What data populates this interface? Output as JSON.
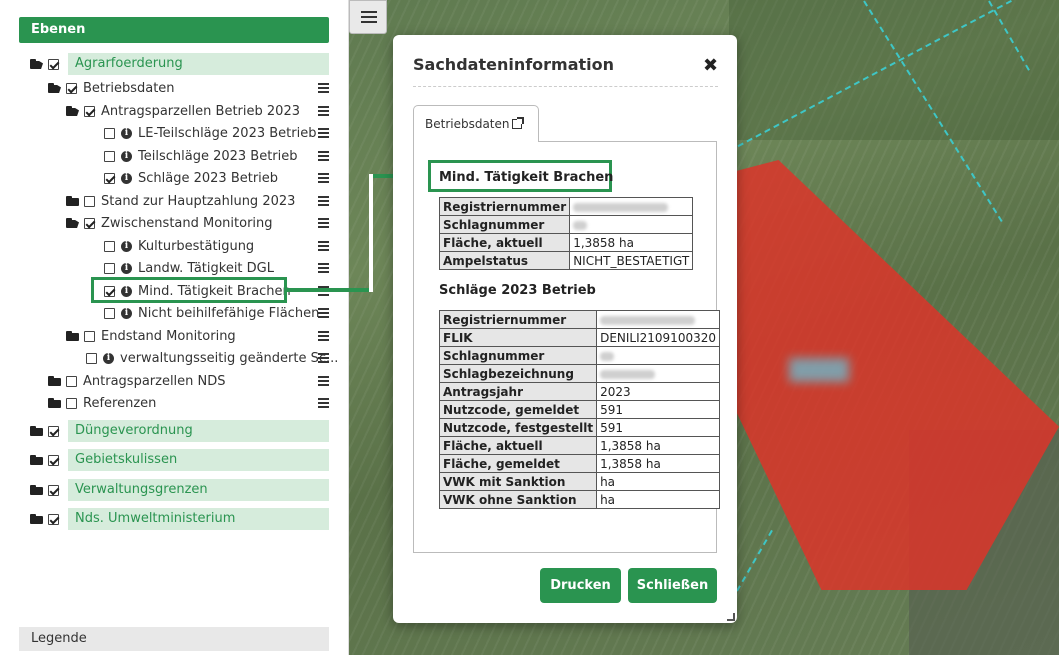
{
  "sidebar": {
    "header": "Ebenen",
    "legend": "Legende",
    "tree": {
      "agrar": "Agrarfoerderung",
      "betriebsdaten": "Betriebsdaten",
      "antragsparzellen": "Antragsparzellen Betrieb 2023",
      "le_teilschlaege": "LE-Teilschläge 2023 Betrieb",
      "teilschlaege": "Teilschläge 2023 Betrieb",
      "schlaege": "Schläge 2023 Betrieb",
      "stand_hauptzahlung": "Stand zur Hauptzahlung 2023",
      "zwischenstand": "Zwischenstand Monitoring",
      "kulturbestaetigung": "Kulturbestätigung",
      "landw_taetigkeit": "Landw. Tätigkeit DGL",
      "mind_taetigkeit": "Mind. Tätigkeit Brachen",
      "nicht_beihilfefaehig": "Nicht beihilfefähige Flächen",
      "endstand": "Endstand Monitoring",
      "verwaltungsseitig": "verwaltungsseitig geänderte Sc...",
      "antragsparzellen_nds": "Antragsparzellen NDS",
      "referenzen": "Referenzen",
      "duengeverordnung": "Düngeverordnung",
      "gebietskulissen": "Gebietskulissen",
      "verwaltungsgrenzen": "Verwaltungsgrenzen",
      "nds_umwelt": "Nds. Umweltministerium"
    }
  },
  "modal": {
    "title": "Sachdateninformation",
    "close": "✖",
    "tab_label": "Betriebsdaten",
    "section1": {
      "title": "Mind. Tätigkeit Brachen",
      "rows": [
        {
          "k": "Registriernummer",
          "v": ""
        },
        {
          "k": "Schlagnummer",
          "v": ""
        },
        {
          "k": "Fläche, aktuell",
          "v": "1,3858 ha"
        },
        {
          "k": "Ampelstatus",
          "v": "NICHT_BESTAETIGT"
        }
      ]
    },
    "section2": {
      "title": "Schläge 2023 Betrieb",
      "rows": [
        {
          "k": "Registriernummer",
          "v": ""
        },
        {
          "k": "FLIK",
          "v": "DENILI2109100320"
        },
        {
          "k": "Schlagnummer",
          "v": ""
        },
        {
          "k": "Schlagbezeichnung",
          "v": ""
        },
        {
          "k": "Antragsjahr",
          "v": "2023"
        },
        {
          "k": "Nutzcode, gemeldet",
          "v": "591"
        },
        {
          "k": "Nutzcode, festgestellt",
          "v": "591"
        },
        {
          "k": "Fläche, aktuell",
          "v": "1,3858 ha"
        },
        {
          "k": "Fläche, gemeldet",
          "v": "1,3858 ha"
        },
        {
          "k": "VWK mit Sanktion",
          "v": "ha"
        },
        {
          "k": "VWK ohne Sanktion",
          "v": "ha"
        }
      ]
    },
    "buttons": {
      "print": "Drucken",
      "close": "Schließen"
    }
  },
  "colors": {
    "accent": "#2a9450",
    "highlight_area": "#e13228",
    "parcel_border": "#3ec6c6"
  }
}
